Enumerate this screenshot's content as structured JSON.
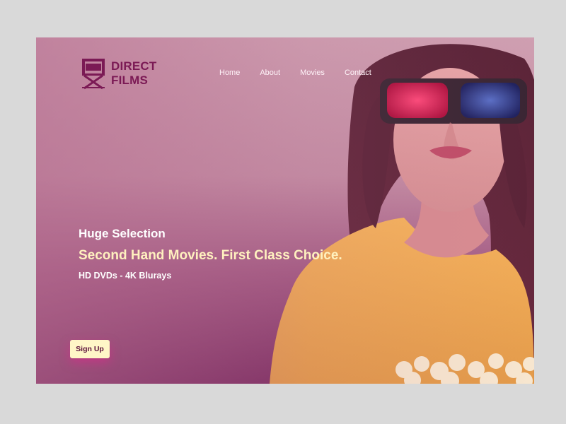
{
  "brand": {
    "line1": "DIRECT",
    "line2": "FILMS",
    "icon": "director-chair-icon"
  },
  "nav": {
    "items": [
      {
        "label": "Home"
      },
      {
        "label": "About"
      },
      {
        "label": "Movies"
      },
      {
        "label": "Contact"
      }
    ]
  },
  "hero": {
    "title": "Huge Selection",
    "tagline": "Second Hand Movies. First Class Choice.",
    "subtitle": "HD DVDs - 4K Blurays",
    "cta_label": "Sign Up"
  },
  "colors": {
    "brand": "#7b1a55",
    "accent": "#fff1bf",
    "button_bg": "#fff6c7"
  }
}
